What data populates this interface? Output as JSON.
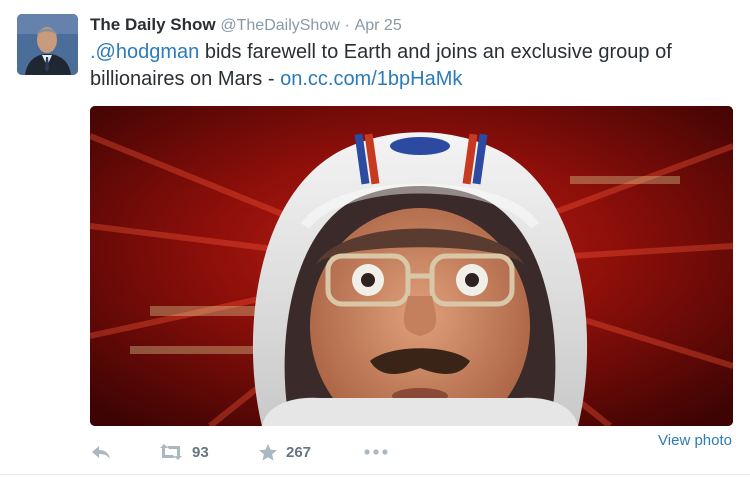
{
  "tweet": {
    "fullname": "The Daily Show",
    "username": "@TheDailyShow",
    "separator": "·",
    "time": "Apr 25",
    "mention": ".@hodgman",
    "body": " bids farewell to Earth and joins an exclusive group of billionaires on Mars - ",
    "link": "on.cc.com/1bpHaMk"
  },
  "actions": {
    "reply_icon": "reply-icon",
    "retweet_icon": "retweet-icon",
    "retweet_count": "93",
    "favorite_icon": "star-icon",
    "favorite_count": "267",
    "more_icon": "more-dots-icon",
    "view_photo": "View photo"
  },
  "colors": {
    "link": "#2b7bb9",
    "muted": "#8899a6",
    "text": "#292f33"
  }
}
